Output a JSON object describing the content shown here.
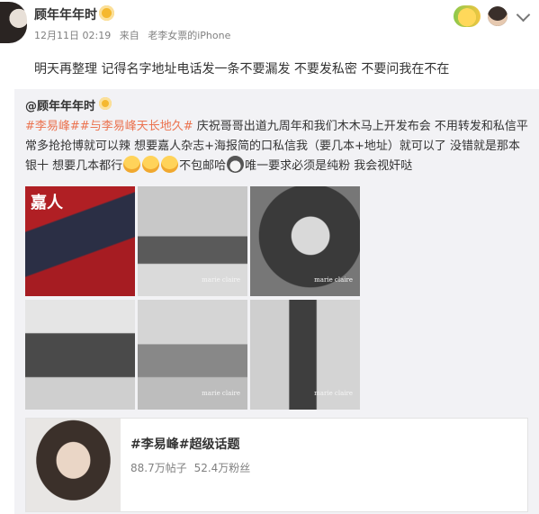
{
  "post": {
    "user_name": "顾年年年时",
    "date": "12月11日 02:19",
    "via": "来自",
    "source": "老李女票的iPhone",
    "text": "明天再整理 记得名字地址电话发一条不要漏发  不要发私密 不要问我在不在"
  },
  "header_icons": [
    "vip-icon",
    "emoji-badge-icon",
    "avatar",
    "chevron-down-icon"
  ],
  "repost": {
    "user_name": "@顾年年年时",
    "topic1": "#李易峰#",
    "topic2": "#与李易峰天长地久#",
    "text1": " 庆祝哥哥出道九周年和我们木木马上开发布会 不用转发和私信平常多抢抢博就可以辣 想要嘉人杂志+海报简的口私信我（要几本+地址）就可以了 没错就是那本银十 想要几本都行",
    "text2": "不包邮哈",
    "text3": "唯一要求必须是纯粉 我会视奸哒",
    "cover_title": "嘉人",
    "watermark": "marie claire"
  },
  "topic_card": {
    "title": "#李易峰#超级话题",
    "posts": "88.7万帖子",
    "fans": "52.4万粉丝"
  },
  "colors": {
    "link": "#eb7350",
    "meta": "#808080",
    "repost_bg": "#f2f2f5"
  }
}
